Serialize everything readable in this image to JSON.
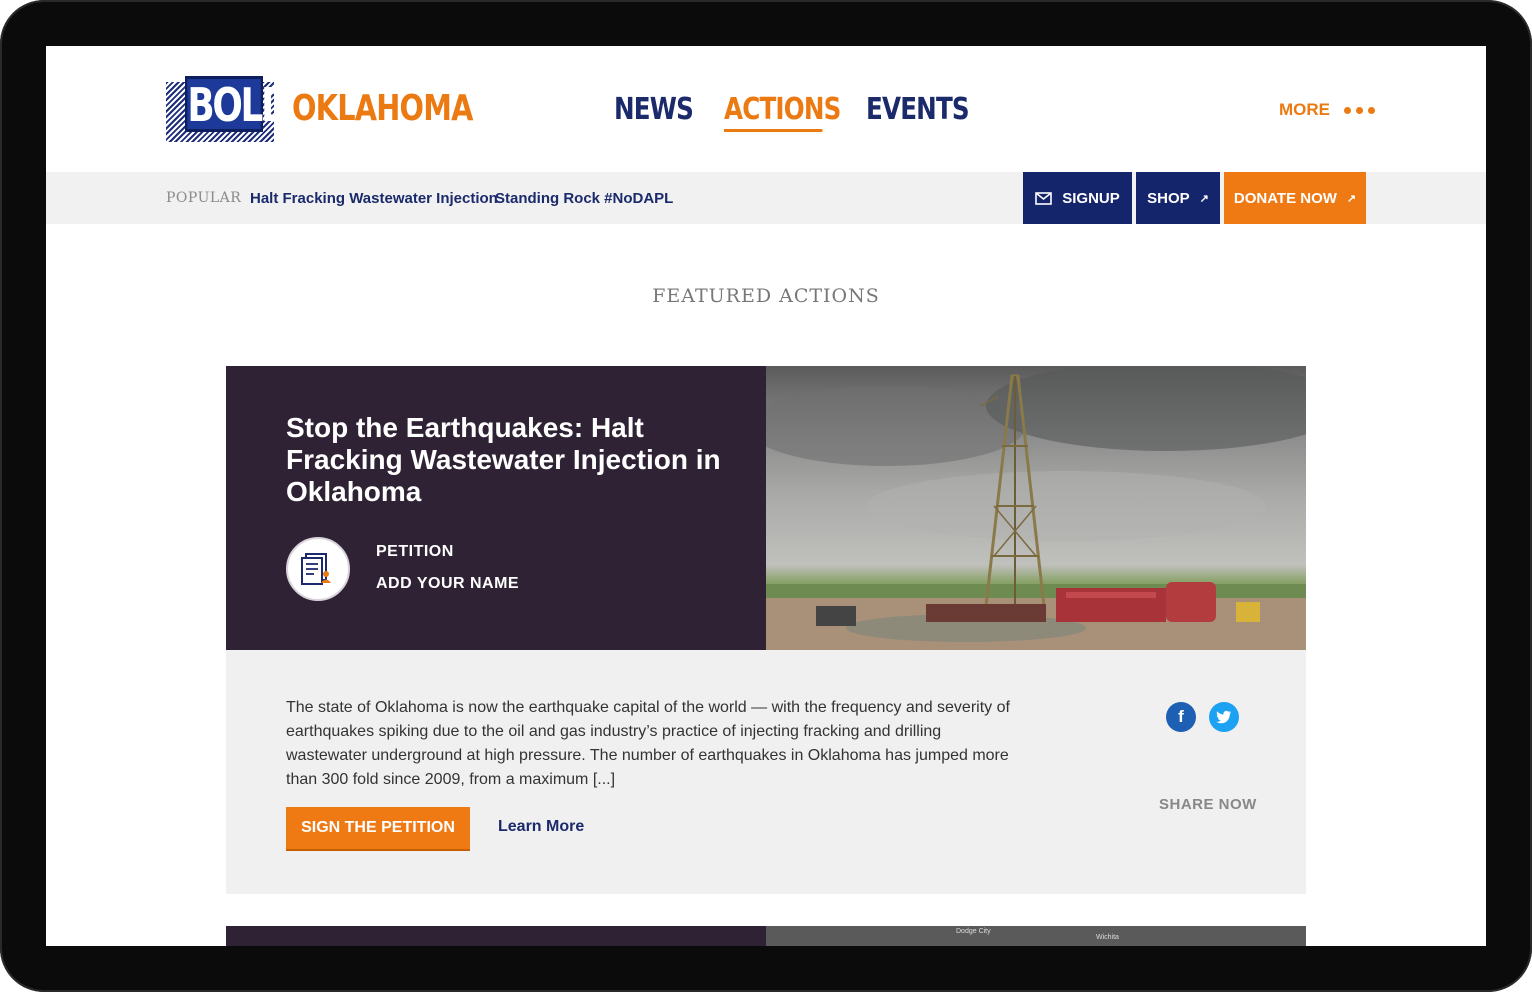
{
  "brand": {
    "logo_word": "BOLD",
    "state_name": "OKLAHOMA",
    "colors": {
      "navy": "#1b2a6b",
      "orange": "#ec7a12",
      "purple": "#2f2234"
    }
  },
  "nav": {
    "items": [
      {
        "label": "NEWS",
        "active": false
      },
      {
        "label": "ACTIONS",
        "active": true
      },
      {
        "label": "EVENTS",
        "active": false
      }
    ],
    "more_label": "MORE"
  },
  "popular": {
    "label": "POPULAR",
    "links": [
      "Halt Fracking Wastewater Injection",
      "Standing Rock #NoDAPL"
    ]
  },
  "actions_bar": {
    "signup_label": "SIGNUP",
    "shop_label": "SHOP",
    "donate_label": "DONATE NOW"
  },
  "featured": {
    "section_title": "FEATURED ACTIONS",
    "card": {
      "title": "Stop the Earthquakes: Halt Fracking Wastewater Injection in Oklahoma",
      "type_label": "PETITION",
      "cta_label": "ADD YOUR NAME",
      "description": "The state of Oklahoma is now the earthquake capital of the world — with the frequency and severity of earthquakes spiking due to the oil and gas industry’s practice of injecting fracking and drilling wastewater underground at high pressure. The number of earthquakes in Oklahoma has jumped more than 300 fold since 2009, from a maximum [...]",
      "sign_button": "SIGN THE PETITION",
      "learn_more": "Learn More",
      "share_label": "SHARE NOW"
    },
    "next_card_map_labels": [
      "Dodge City",
      "Wichita"
    ]
  },
  "icons": [
    "envelope-icon",
    "external-arrow-icon",
    "document-icon",
    "facebook-icon",
    "twitter-icon",
    "dots-icon"
  ]
}
